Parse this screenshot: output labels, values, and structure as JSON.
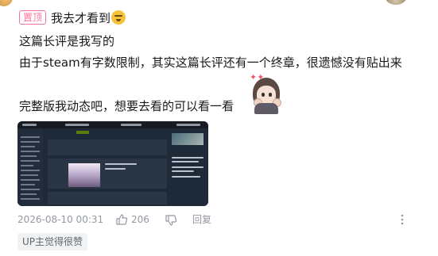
{
  "comment": {
    "pinned_label": "置顶",
    "line1": "我去才看到",
    "line2": "这篇长评是我写的",
    "line3": "由于steam有字数限制，其实这篇长评还有一个终章，很遗憾没有贴出来",
    "line4": "完整版我动态吧，想要去看的可以看一看",
    "emoji_icon": "laughing-emoji",
    "sticker_icon": "angry-anime-girl-sticker"
  },
  "image": {
    "alt_icon": "steam-review-screenshot-thumbnail",
    "accent": "#1b2838"
  },
  "meta": {
    "timestamp": "2026-08-10 00:31",
    "like_count": "206",
    "reply_label": "回复"
  },
  "badge": {
    "label": "UP主觉得很赞"
  },
  "colors": {
    "pin_badge": "#fb7299",
    "meta_text": "#9499a0",
    "badge_bg": "#f1f2f3"
  }
}
